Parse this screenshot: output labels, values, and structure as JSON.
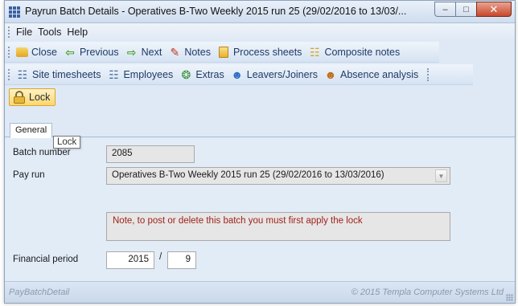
{
  "window": {
    "title": "Payrun Batch Details - Operatives B-Two Weekly    2015 run 25 (29/02/2016 to 13/03/..."
  },
  "menu": {
    "items": [
      "File",
      "Tools",
      "Help"
    ]
  },
  "toolbar1": {
    "close": "Close",
    "previous": "Previous",
    "next": "Next",
    "notes": "Notes",
    "process_sheets": "Process sheets",
    "composite_notes": "Composite notes"
  },
  "toolbar2": {
    "site_timesheets": "Site timesheets",
    "employees": "Employees",
    "extras": "Extras",
    "leavers_joiners": "Leavers/Joiners",
    "absence_analysis": "Absence analysis"
  },
  "toolbar3": {
    "lock": "Lock"
  },
  "tabs": {
    "general": "General"
  },
  "tooltip": {
    "text": "Lock"
  },
  "form": {
    "batch_number_label": "Batch number",
    "batch_number_value": "2085",
    "pay_run_label": "Pay run",
    "pay_run_value": "Operatives B-Two Weekly    2015 run 25 (29/02/2016 to 13/03/2016)",
    "note": "Note, to post or delete this batch you must first apply the lock",
    "financial_period_label": "Financial period",
    "financial_year": "2015",
    "period_separator": "/",
    "financial_period": "9"
  },
  "status": {
    "left": "PayBatchDetail",
    "right": "© 2015 Templa Computer Systems Ltd"
  },
  "icons": {
    "close": "folder-icon",
    "previous": "arrow-left-icon",
    "next": "arrow-right-icon",
    "notes": "notes-icon",
    "process_sheets": "sheet-icon",
    "composite_notes": "composite-notes-icon",
    "site_timesheets": "timesheet-icon",
    "employees": "employees-icon",
    "extras": "extras-icon",
    "leavers_joiners": "leavers-joiners-icon",
    "absence_analysis": "absence-icon",
    "lock": "lock-icon"
  },
  "colors": {
    "note_text": "#a0231b",
    "lock_highlight": "#ffd66b",
    "panel_background": "#e2ecf7"
  }
}
